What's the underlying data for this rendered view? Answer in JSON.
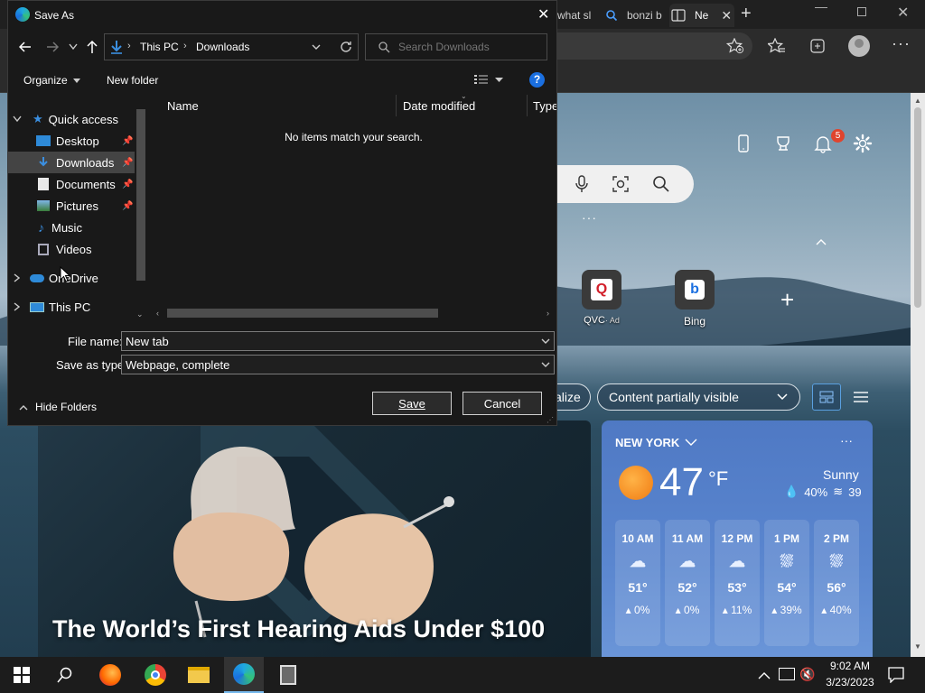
{
  "browser": {
    "tabs": [
      {
        "label": "what sl"
      },
      {
        "label": "bonzi b"
      },
      {
        "label": "Ne"
      }
    ]
  },
  "newtab": {
    "quick_links": [
      {
        "label": "QVC",
        "ad": "· Ad"
      },
      {
        "label": "Bing"
      }
    ],
    "notif_count": "5",
    "personalize_chip": "alize",
    "content_chip": "Content partially visible",
    "news_title": "The World’s First Hearing Aids Under $100",
    "weather": {
      "location": "NEW YORK",
      "temp": "47",
      "unit": "°F",
      "condition": "Sunny",
      "precip": "40%",
      "wind": "39",
      "hours": [
        {
          "time": "10 AM",
          "temp": "51°",
          "rain": "0%"
        },
        {
          "time": "11 AM",
          "temp": "52°",
          "rain": "0%"
        },
        {
          "time": "12 PM",
          "temp": "53°",
          "rain": "11%"
        },
        {
          "time": "1 PM",
          "temp": "54°",
          "rain": "39%"
        },
        {
          "time": "2 PM",
          "temp": "56°",
          "rain": "40%"
        }
      ]
    }
  },
  "dialog": {
    "title": "Save As",
    "breadcrumb": [
      "This PC",
      "Downloads"
    ],
    "search_placeholder": "Search Downloads",
    "organize": "Organize",
    "new_folder": "New folder",
    "tree": [
      {
        "label": "Quick access"
      },
      {
        "label": "Desktop"
      },
      {
        "label": "Downloads"
      },
      {
        "label": "Documents"
      },
      {
        "label": "Pictures"
      },
      {
        "label": "Music"
      },
      {
        "label": "Videos"
      },
      {
        "label": "OneDrive"
      },
      {
        "label": "This PC"
      }
    ],
    "columns": [
      "Name",
      "Date modified",
      "Type"
    ],
    "empty_message": "No items match your search.",
    "file_name_label": "File name:",
    "file_name_value": "New tab",
    "save_type_label": "Save as type:",
    "save_type_value": "Webpage, complete",
    "hide_folders": "Hide Folders",
    "save": "Save",
    "cancel": "Cancel"
  },
  "taskbar": {
    "time": "9:02 AM",
    "date": "3/23/2023"
  },
  "colors": {
    "accent": "#0078d4",
    "dialog_bg": "#191919",
    "weather_bg": "#5a86cf",
    "badge": "#e0442e"
  }
}
